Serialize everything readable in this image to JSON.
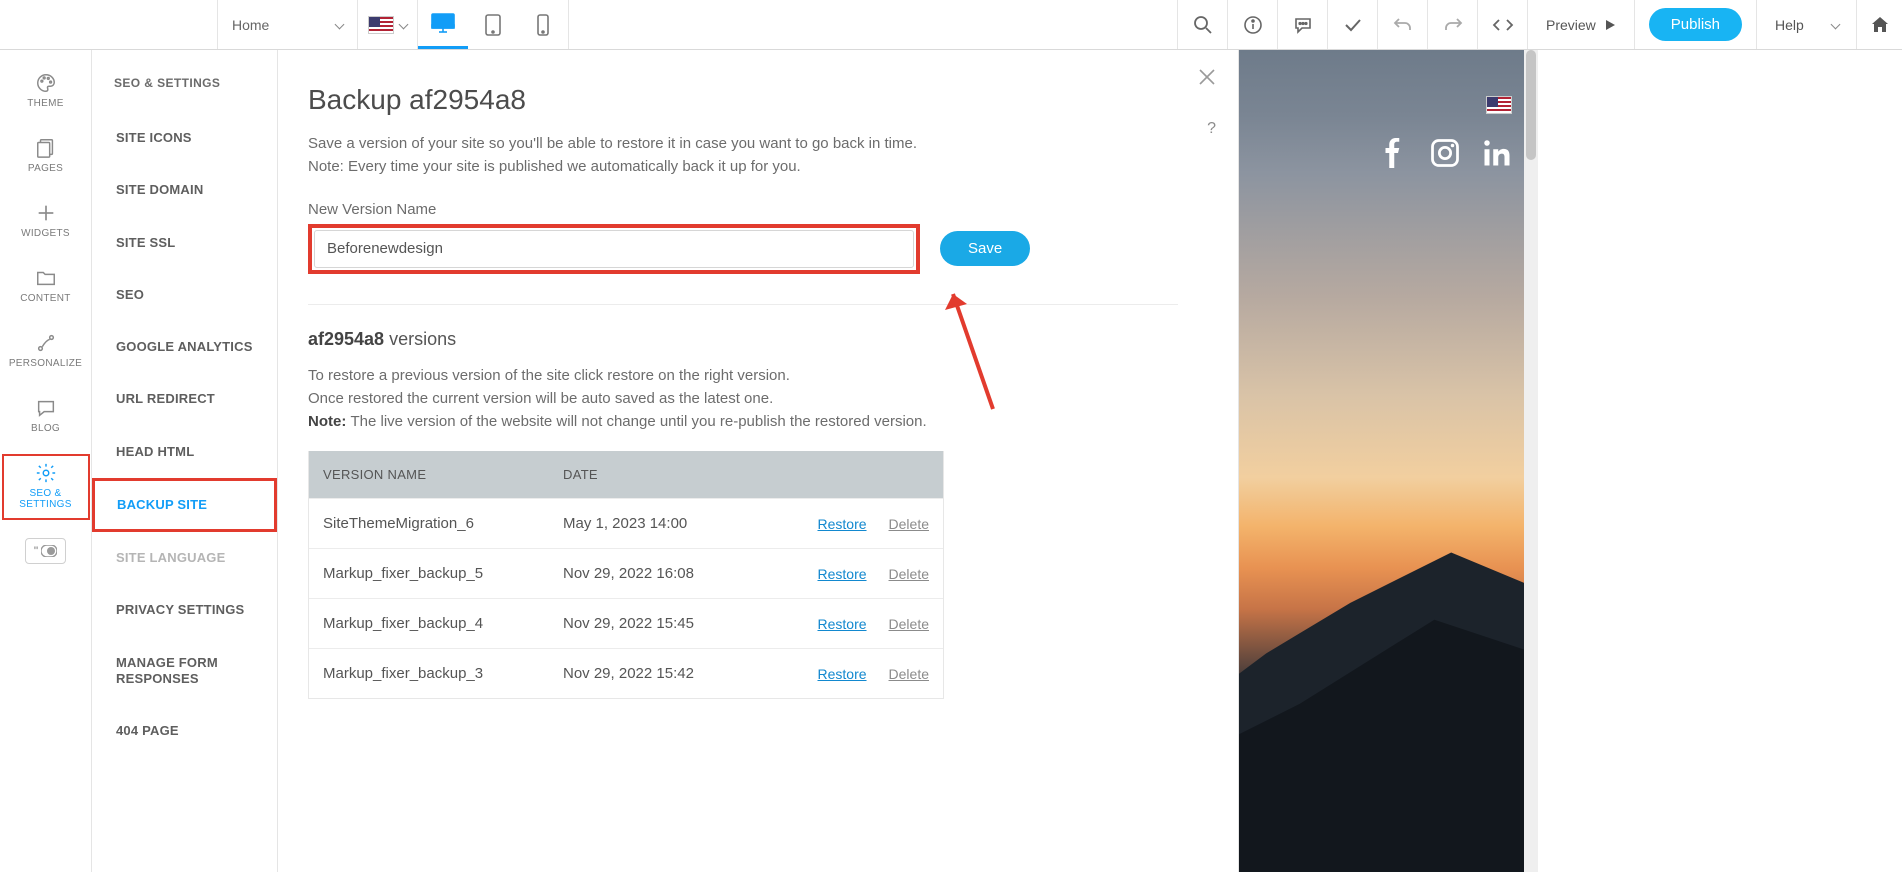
{
  "topbar": {
    "page_dropdown": "Home",
    "preview_label": "Preview",
    "publish_label": "Publish",
    "help_label": "Help"
  },
  "rail": {
    "items": [
      {
        "label": "THEME"
      },
      {
        "label": "PAGES"
      },
      {
        "label": "WIDGETS"
      },
      {
        "label": "CONTENT"
      },
      {
        "label": "PERSONALIZE"
      },
      {
        "label": "BLOG"
      },
      {
        "label": "SEO & SETTINGS"
      }
    ]
  },
  "submenu": {
    "title": "SEO & SETTINGS",
    "items": [
      {
        "label": "SITE ICONS"
      },
      {
        "label": "SITE DOMAIN"
      },
      {
        "label": "SITE SSL"
      },
      {
        "label": "SEO"
      },
      {
        "label": "GOOGLE ANALYTICS"
      },
      {
        "label": "URL REDIRECT"
      },
      {
        "label": "HEAD HTML"
      },
      {
        "label": "BACKUP SITE"
      },
      {
        "label": "SITE LANGUAGE"
      },
      {
        "label": "PRIVACY SETTINGS"
      },
      {
        "label": "MANAGE FORM RESPONSES"
      },
      {
        "label": "404 PAGE"
      }
    ],
    "active_index": 7,
    "disabled_index": 8
  },
  "content": {
    "title": "Backup af2954a8",
    "desc_line1": "Save a version of your site so you'll be able to restore it in case you want to go back in time.",
    "desc_line2": "Note: Every time your site is published we automatically back it up for you.",
    "field_label": "New Version Name",
    "input_value": "Beforenewdesign",
    "save_label": "Save",
    "versions_id": "af2954a8",
    "versions_word": " versions",
    "restore_desc1": "To restore a previous version of the site click restore on the right version.",
    "restore_desc2": "Once restored the current version will be auto saved as the latest one.",
    "restore_note_label": "Note: ",
    "restore_note_text": "The live version of the website will not change until you re-publish the restored version.",
    "table": {
      "head_name": "VERSION NAME",
      "head_date": "DATE",
      "restore_label": "Restore",
      "delete_label": "Delete",
      "rows": [
        {
          "name": "SiteThemeMigration_6",
          "date": "May 1, 2023 14:00"
        },
        {
          "name": "Markup_fixer_backup_5",
          "date": "Nov 29, 2022 16:08"
        },
        {
          "name": "Markup_fixer_backup_4",
          "date": "Nov 29, 2022 15:45"
        },
        {
          "name": "Markup_fixer_backup_3",
          "date": "Nov 29, 2022 15:42"
        }
      ]
    },
    "help_icon": "?"
  }
}
